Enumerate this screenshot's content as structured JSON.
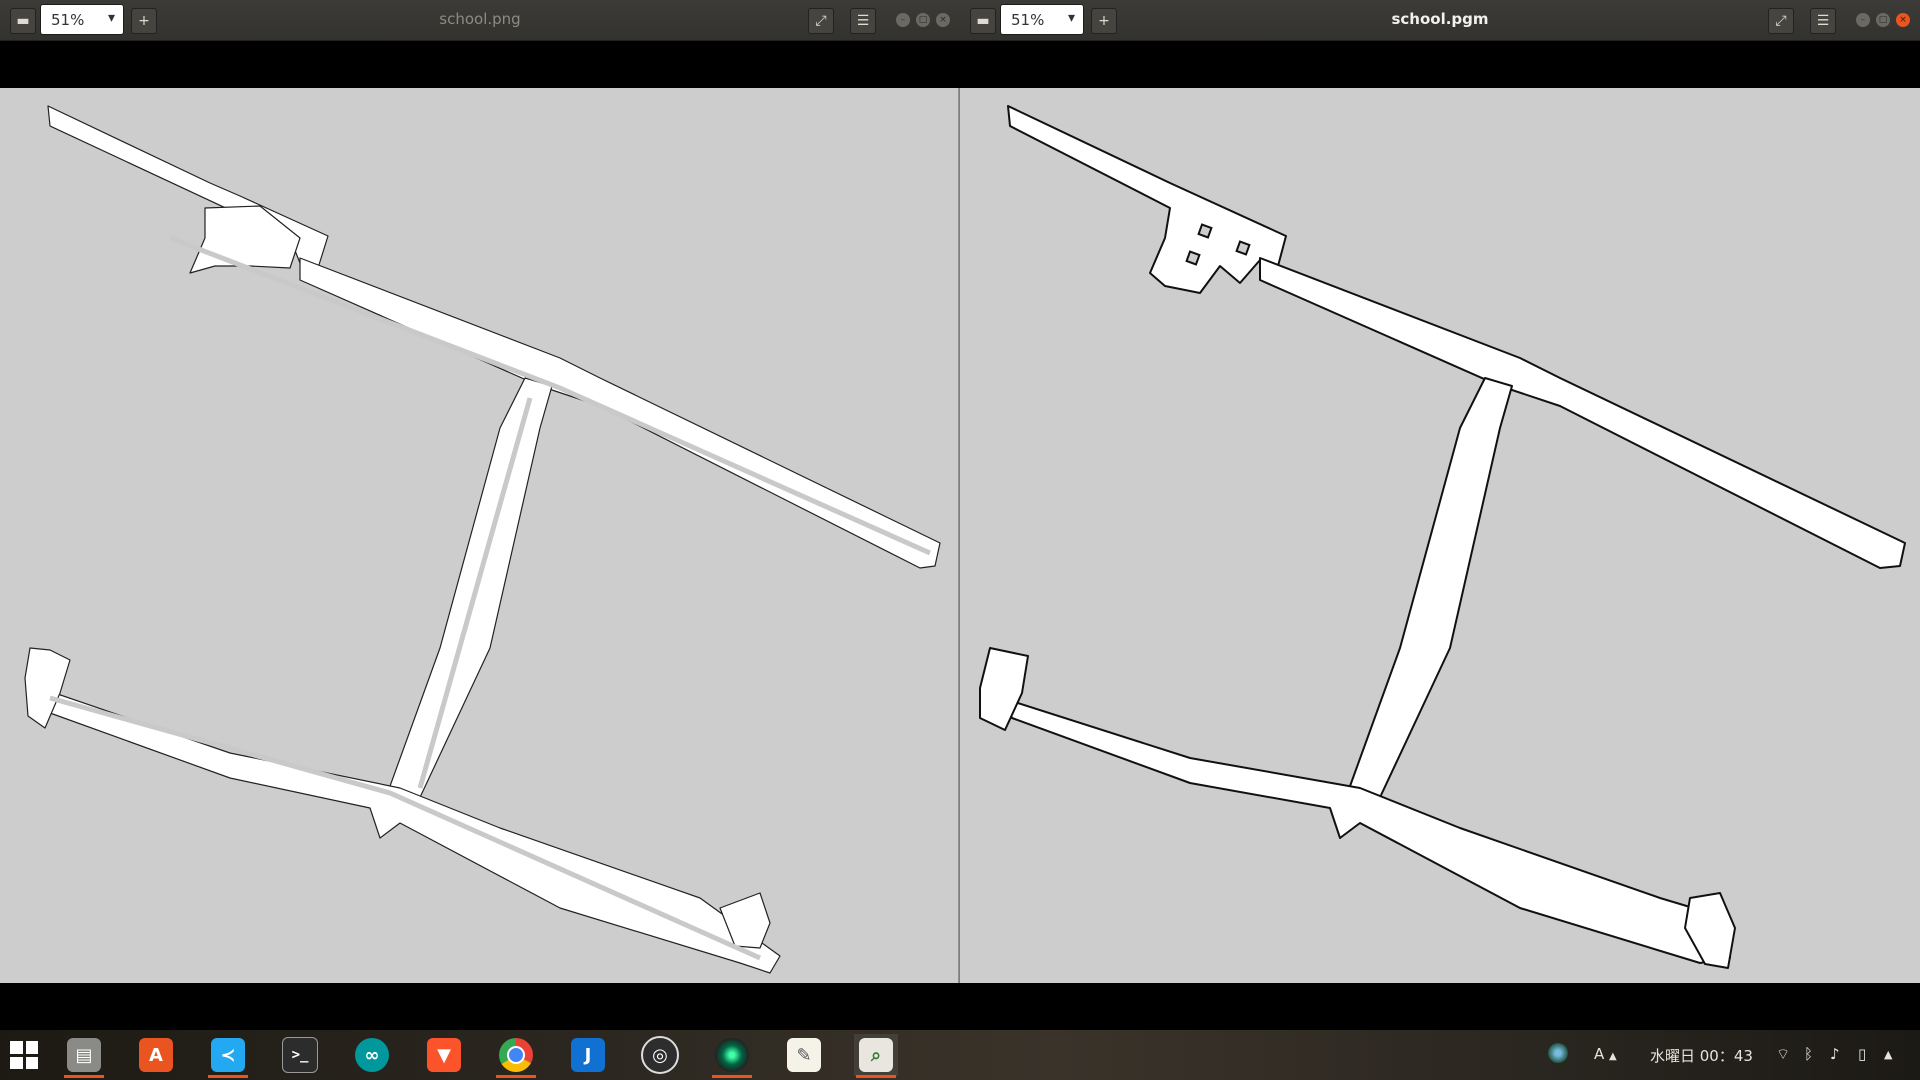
{
  "left_window": {
    "title": "school.png",
    "title_active": false,
    "zoom": "51%",
    "zoom_out_icon": "minus-icon",
    "zoom_in_icon": "plus-icon",
    "fullscreen_icon": "expand-icon",
    "menu_icon": "hamburger-icon"
  },
  "right_window": {
    "title": "school.pgm",
    "title_active": true,
    "zoom": "51%",
    "zoom_out_icon": "minus-icon",
    "zoom_in_icon": "plus-icon",
    "fullscreen_icon": "expand-icon",
    "menu_icon": "hamburger-icon"
  },
  "colors": {
    "map_background": "#cdcdcd",
    "free_space": "#ffffff",
    "wall": "#111111",
    "accent": "#e95420"
  },
  "taskbar": {
    "apps": [
      {
        "name": "app-grid",
        "icon": "grid-icon",
        "running": false
      },
      {
        "name": "files",
        "icon": "file-cabinet-icon",
        "running": true
      },
      {
        "name": "software-center",
        "icon": "shopping-bag-icon",
        "running": false
      },
      {
        "name": "vscode",
        "icon": "vscode-icon",
        "running": true
      },
      {
        "name": "terminal",
        "icon": "terminal-icon",
        "running": false
      },
      {
        "name": "arduino",
        "icon": "infinity-icon",
        "running": false
      },
      {
        "name": "brave",
        "icon": "lion-icon",
        "running": false
      },
      {
        "name": "chrome",
        "icon": "chrome-icon",
        "running": true
      },
      {
        "name": "joplin",
        "icon": "j-icon",
        "running": false
      },
      {
        "name": "obs",
        "icon": "obs-icon",
        "running": false
      },
      {
        "name": "camera",
        "icon": "lens-icon",
        "running": true
      },
      {
        "name": "text-editor",
        "icon": "notepad-icon",
        "running": false
      },
      {
        "name": "image-viewer",
        "icon": "magnifier-image-icon",
        "running": true
      }
    ],
    "input_method": "A",
    "clock": "水曜日 00：43"
  }
}
